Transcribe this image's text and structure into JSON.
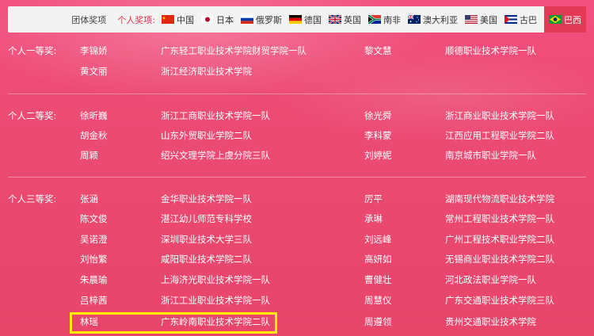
{
  "nav": {
    "team_award": "团体奖项",
    "individual_award": "个人奖项:",
    "tabs": [
      {
        "label": "中国",
        "icon": "flag-china-icon"
      },
      {
        "label": "日本",
        "icon": "flag-japan-icon"
      },
      {
        "label": "俄罗斯",
        "icon": "flag-russia-icon"
      },
      {
        "label": "德国",
        "icon": "flag-germany-icon"
      },
      {
        "label": "英国",
        "icon": "flag-uk-icon"
      },
      {
        "label": "南非",
        "icon": "flag-south-africa-icon"
      },
      {
        "label": "澳大利亚",
        "icon": "flag-australia-icon"
      },
      {
        "label": "美国",
        "icon": "flag-usa-icon"
      },
      {
        "label": "古巴",
        "icon": "flag-cuba-icon"
      },
      {
        "label": "巴西",
        "icon": "flag-brazil-icon"
      }
    ],
    "active_tab": "巴西"
  },
  "first_prize": {
    "title": "个人一等奖:",
    "left": [
      {
        "name": "李锦娇",
        "school": "广东轻工职业技术学院财贸学院一队"
      },
      {
        "name": "黄文丽",
        "school": "浙江经济职业技术学院"
      }
    ],
    "right": [
      {
        "name": "黎文慧",
        "school": "顺德职业技术学院一队"
      }
    ]
  },
  "second_prize": {
    "title": "个人二等奖:",
    "left": [
      {
        "name": "徐昕巍",
        "school": "浙江工商职业技术学院一队"
      },
      {
        "name": "胡金秋",
        "school": "山东外贸职业学院二队"
      },
      {
        "name": "周颖",
        "school": "绍兴文理学院上虞分院三队"
      }
    ],
    "right": [
      {
        "name": "徐光舜",
        "school": "浙江商业职业技术学院一队"
      },
      {
        "name": "李科蒙",
        "school": "江西应用工程职业学院二队"
      },
      {
        "name": "刘婷妮",
        "school": "南京城市职业学院一队"
      }
    ]
  },
  "third_prize": {
    "title": "个人三等奖:",
    "left": [
      {
        "name": "张涵",
        "school": "金华职业技术学院一队"
      },
      {
        "name": "陈文俊",
        "school": "湛江幼儿师范专科学校"
      },
      {
        "name": "吴诺澄",
        "school": "深圳职业技术大学三队"
      },
      {
        "name": "刘怡繁",
        "school": "咸阳职业技术学院二队"
      },
      {
        "name": "朱晨瑜",
        "school": "上海济光职业技术学院一队"
      },
      {
        "name": "吕梓茜",
        "school": "浙江工业职业技术学院一队"
      },
      {
        "name": "林瑶",
        "school": "广东岭南职业技术学院二队"
      }
    ],
    "right": [
      {
        "name": "厉平",
        "school": "湖南现代物流职业技术学院"
      },
      {
        "name": "承琳",
        "school": "常州工程职业技术学院一队"
      },
      {
        "name": "刘远峰",
        "school": "广州工程技术职业学院二队"
      },
      {
        "name": "高妍如",
        "school": "无锡商业职业技术学院二队"
      },
      {
        "name": "曹健壮",
        "school": "河北政法职业学院一队"
      },
      {
        "name": "周慧仪",
        "school": "广东交通职业技术学院三队"
      },
      {
        "name": "周遵领",
        "school": "贵州交通职业技术学院"
      }
    ]
  },
  "highlight_color": "#ffee00"
}
